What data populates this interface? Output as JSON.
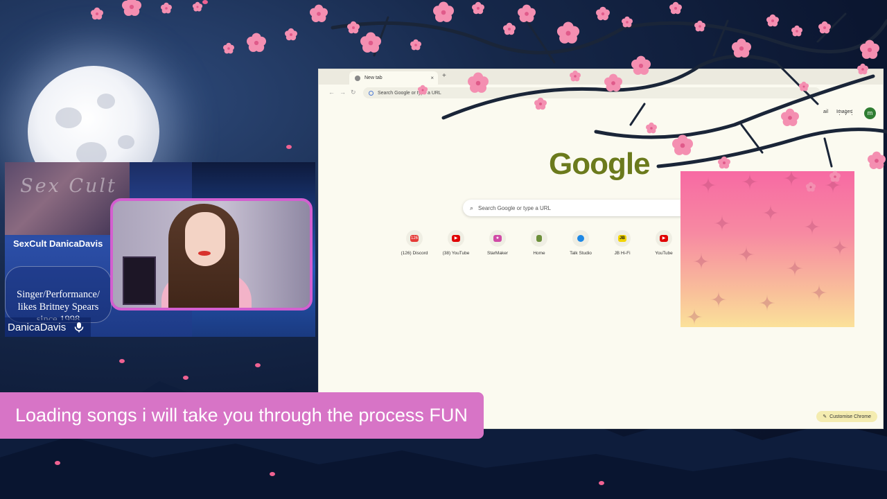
{
  "browser": {
    "tab_title": "New tab",
    "tab_close": "×",
    "new_tab": "+",
    "address_placeholder": "Search Google or type a URL",
    "top_links": [
      "ail",
      "Images"
    ],
    "account_initial": "m",
    "logo": "Google",
    "search_placeholder": "Search Google or type a URL",
    "shortcuts": [
      {
        "label": "(126) Discord",
        "icon": "discord-icon",
        "badge": "126",
        "color": "#e53935"
      },
      {
        "label": "(38) YouTube",
        "icon": "youtube-icon",
        "badge": "",
        "color": "#e00000"
      },
      {
        "label": "StarMaker",
        "icon": "starmaker-icon",
        "badge": "",
        "color": "#d04aa6"
      },
      {
        "label": "Home",
        "icon": "home-icon",
        "badge": "",
        "color": "#6c8f3a"
      },
      {
        "label": "Talk Studio",
        "icon": "talk-studio-icon",
        "badge": "",
        "color": "#1e88e5"
      },
      {
        "label": "JB Hi-Fi",
        "icon": "jbhifi-icon",
        "badge": "JB",
        "color": "#f2d400"
      },
      {
        "label": "YouTube",
        "icon": "youtube-icon",
        "badge": "",
        "color": "#e00000"
      }
    ],
    "customise_label": "Customise Chrome"
  },
  "profile": {
    "script_text": "Sex Cult",
    "name": "SexCult DanicaDavis",
    "bio": "Singer/Performance/ likes Britney Spears since 1998"
  },
  "cam": {
    "label": "DanicaDavis"
  },
  "caption": "Loading songs i will take you through the process FUN",
  "colors": {
    "caption_bg": "#d774c6",
    "cam_border": "#d35fd0",
    "blossom": "#f48fb1"
  }
}
